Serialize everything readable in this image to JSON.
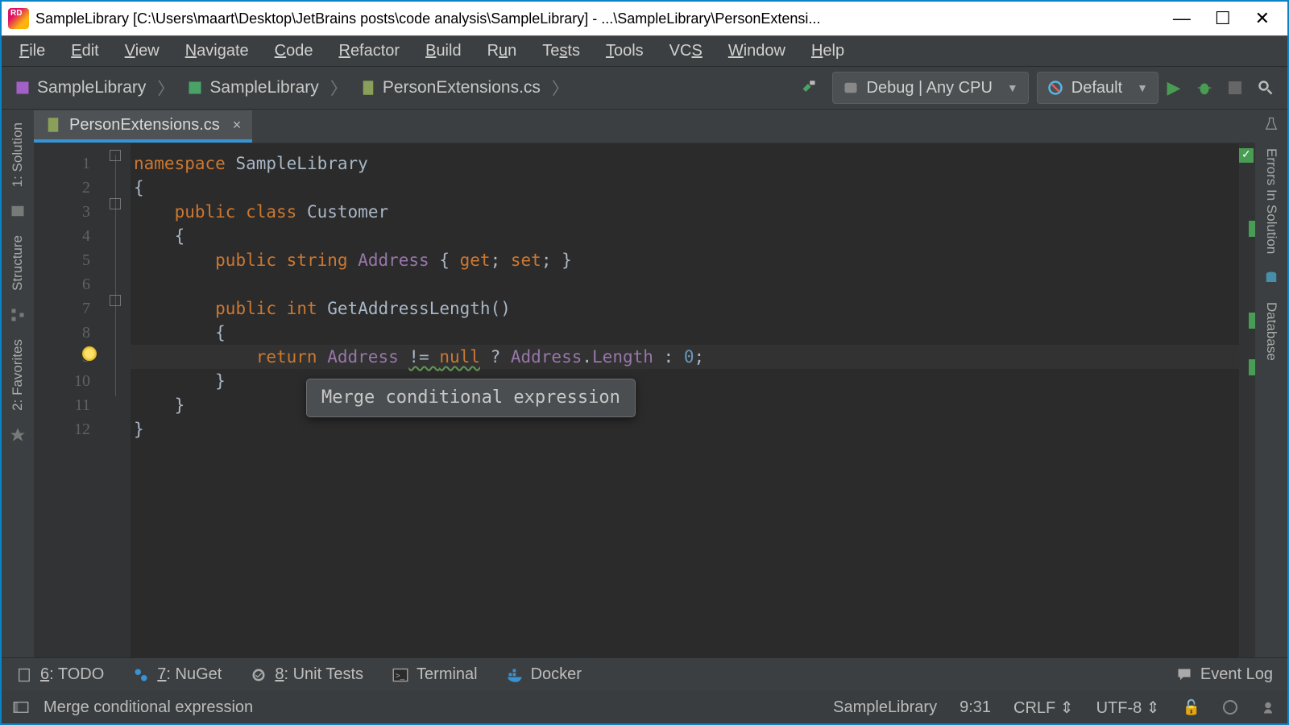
{
  "title": "SampleLibrary [C:\\Users\\maart\\Desktop\\JetBrains posts\\code analysis\\SampleLibrary] - ...\\SampleLibrary\\PersonExtensi...",
  "menu": [
    "File",
    "Edit",
    "View",
    "Navigate",
    "Code",
    "Refactor",
    "Build",
    "Run",
    "Tests",
    "Tools",
    "VCS",
    "Window",
    "Help"
  ],
  "breadcrumbs": [
    "SampleLibrary",
    "SampleLibrary",
    "PersonExtensions.cs"
  ],
  "run_config": "Debug | Any CPU",
  "profile": "Default",
  "tab": {
    "label": "PersonExtensions.cs"
  },
  "left_tabs": {
    "solution": "1: Solution",
    "structure": "Structure",
    "favorites": "2: Favorites"
  },
  "right_tabs": {
    "errors": "Errors In Solution",
    "database": "Database"
  },
  "code_lines": [
    "namespace SampleLibrary",
    "{",
    "    public class Customer",
    "    {",
    "        public string Address { get; set; }",
    "",
    "        public int GetAddressLength()",
    "        {",
    "            return Address != null ? Address.Length : 0;",
    "        }",
    "    }",
    "}"
  ],
  "tooltip": "Merge conditional expression",
  "bottom": {
    "todo": "6: TODO",
    "nuget": "7: NuGet",
    "unit": "8: Unit Tests",
    "terminal": "Terminal",
    "docker": "Docker",
    "eventlog": "Event Log"
  },
  "status": {
    "msg": "Merge conditional expression",
    "project": "SampleLibrary",
    "pos": "9:31",
    "eol": "CRLF",
    "enc": "UTF-8"
  }
}
